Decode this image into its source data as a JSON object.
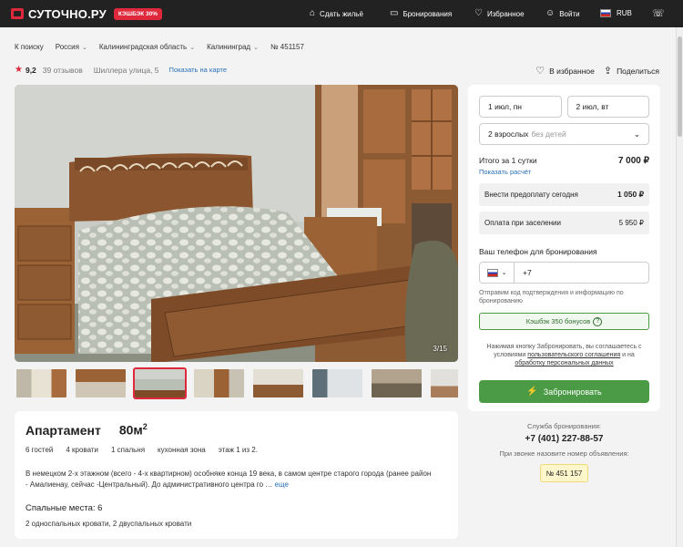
{
  "header": {
    "logo": "СУТОЧНО.РУ",
    "cashback_badge": "КЭШБЭК 30%",
    "nav": {
      "list_property": "Сдать жильё",
      "bookings": "Бронирования",
      "favorites": "Избранное",
      "login": "Войти",
      "currency": "RUB"
    }
  },
  "breadcrumbs": {
    "back": "К поиску",
    "country": "Россия",
    "region": "Калининградская область",
    "city": "Калининград",
    "listing": "№ 451157"
  },
  "summary": {
    "rating": "9,2",
    "reviews": "39 отзывов",
    "address": "Шиллера улица, 5",
    "map_link": "Показать на карте",
    "favorite": "В избранное",
    "share": "Поделиться"
  },
  "gallery": {
    "counter": "3/15"
  },
  "listing": {
    "type": "Апартамент",
    "area": "80м",
    "area_sup": "2",
    "guests": "6 гостей",
    "beds": "4 кровати",
    "bedrooms": "1 спальня",
    "kitchen": "кухонная зона",
    "floor": "этаж 1 из 2.",
    "description": "В немецком 2-х этажном (всего - 4-х квартирном) особняке конца 19 века, в самом центре старого города (ранее район - Амалиенау, сейчас -Центральный). До административного центра го …",
    "more": "еще",
    "sleeping_title": "Спальные места: 6",
    "sleeping_text": "2 односпальных кровати, 2 двуспальных кровати"
  },
  "booking": {
    "checkin": "1 июл, пн",
    "checkout": "2 июл, вт",
    "guests": "2 взрослых",
    "guests_note": "без детей",
    "total_label": "Итого за 1 сутки",
    "total_value": "7 000 ₽",
    "calc_link": "Показать расчёт",
    "prepay_label": "Внести предоплату сегодня",
    "prepay_value": "1 050 ₽",
    "checkin_pay_label": "Оплата при заселении",
    "checkin_pay_value": "5 950 ₽",
    "phone_label": "Ваш телефон для бронирования",
    "phone_code": "+7",
    "phone_hint": "Отправим код подтверждения и информацию по бронированию",
    "cashback": "Кэшбэк 350 бонусов",
    "agree_1": "Нажимая кнопку Забронировать, вы соглашаетесь с условиями",
    "agree_link_1": "пользовательского соглашения",
    "agree_2": "и на",
    "agree_link_2": "обработку персональных данных",
    "book_button": "Забронировать"
  },
  "service": {
    "label": "Служба бронирования:",
    "phone": "+7 (401) 227-88-57",
    "hint": "При звонке назовите номер объявления:",
    "listing_no": "№ 451 157"
  },
  "colors": {
    "brand_red": "#e0283c",
    "action_green": "#4a9a46",
    "link_blue": "#2a6fb8"
  }
}
